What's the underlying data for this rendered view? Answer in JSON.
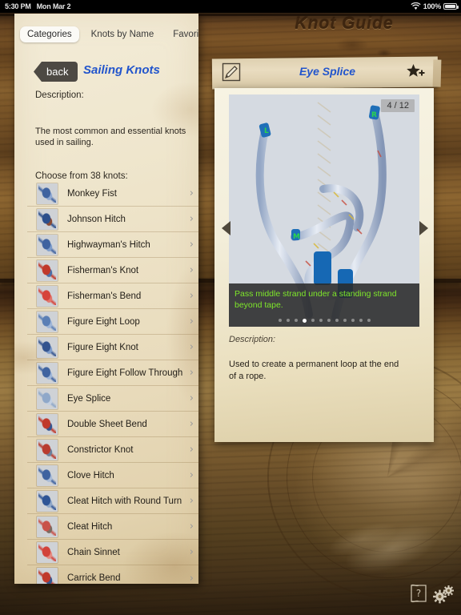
{
  "status_bar": {
    "time": "5:30 PM",
    "date": "Mon Mar 2",
    "wifi_icon": "wifi-icon",
    "battery_percent": "100%",
    "battery_icon": "battery-full-icon"
  },
  "app": {
    "title": "Knot Guide"
  },
  "sidebar": {
    "tabs": [
      {
        "label": "Categories",
        "active": true
      },
      {
        "label": "Knots by Name",
        "active": false
      },
      {
        "label": "Favorites",
        "active": false
      }
    ],
    "back_label": "back",
    "category_title": "Sailing Knots",
    "description_label": "Description:",
    "description_text": "The most common and essential knots used in sailing.",
    "choose_label": "Choose from 38 knots:",
    "knots": [
      {
        "name": "Monkey Fist",
        "chevron": "›"
      },
      {
        "name": "Johnson Hitch",
        "chevron": "›"
      },
      {
        "name": "Highwayman's Hitch",
        "chevron": "›"
      },
      {
        "name": "Fisherman's Knot",
        "chevron": "›"
      },
      {
        "name": "Fisherman's Bend",
        "chevron": "›"
      },
      {
        "name": "Figure Eight Loop",
        "chevron": "›"
      },
      {
        "name": "Figure Eight Knot",
        "chevron": "›"
      },
      {
        "name": "Figure Eight Follow Through",
        "chevron": "›"
      },
      {
        "name": "Eye Splice",
        "chevron": "›"
      },
      {
        "name": "Double Sheet Bend",
        "chevron": "›"
      },
      {
        "name": "Constrictor Knot",
        "chevron": "›"
      },
      {
        "name": "Clove Hitch",
        "chevron": "›"
      },
      {
        "name": "Cleat Hitch with Round Turn",
        "chevron": "›"
      },
      {
        "name": "Cleat Hitch",
        "chevron": "›"
      },
      {
        "name": "Chain Sinnet",
        "chevron": "›"
      },
      {
        "name": "Carrick Bend",
        "chevron": "›"
      }
    ]
  },
  "detail": {
    "edit_icon": "pencil-edit-icon",
    "title": "Eye Splice",
    "favorite_icon": "star-add-favorite-icon",
    "step_counter": "4 / 12",
    "caption": "Pass middle strand under a standing strand beyond tape.",
    "total_steps": 12,
    "current_step": 4,
    "description_label": "Description:",
    "description_text": "Used to create a permanent loop at the end of a rope.",
    "prev_arrow_icon": "triangle-left-icon",
    "next_arrow_icon": "triangle-right-icon"
  },
  "footer": {
    "help_icon": "help-scroll-icon",
    "settings_icon": "gears-settings-icon"
  },
  "colors": {
    "link_blue": "#2255cc",
    "caption_green": "#7ee62a",
    "parchment": "#f0e7ce",
    "wood_dark": "#3a2714"
  }
}
